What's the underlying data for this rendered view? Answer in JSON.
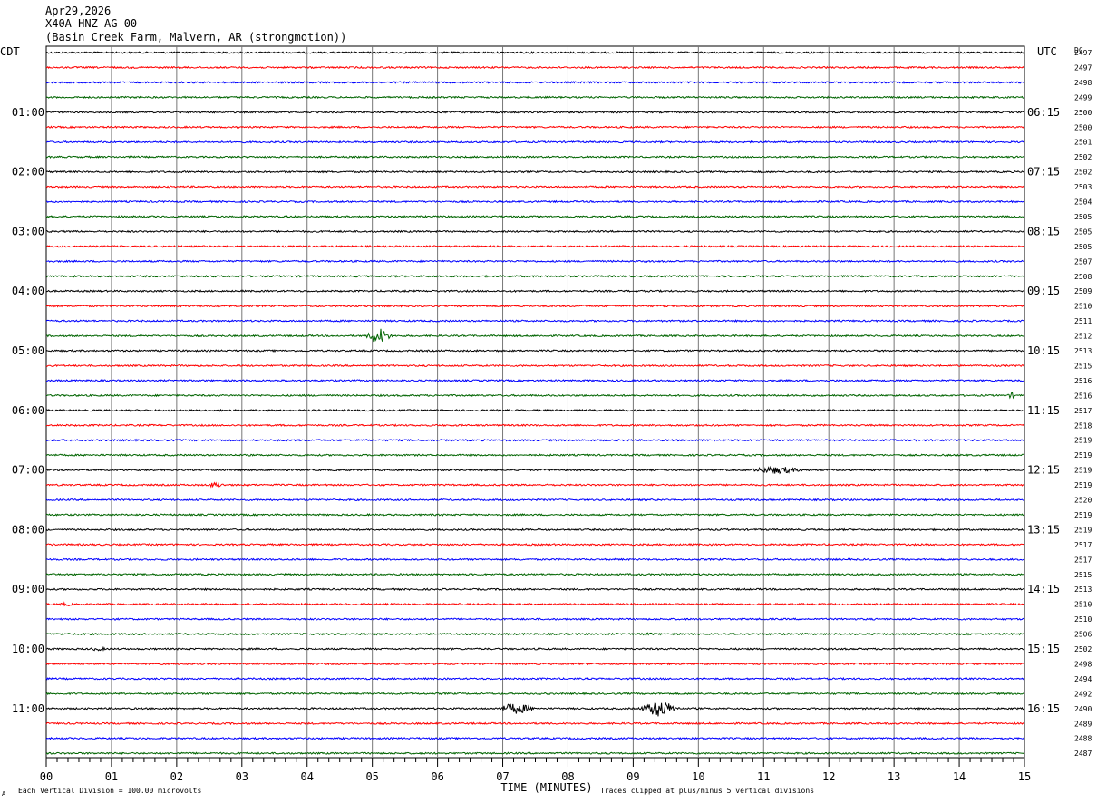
{
  "header": {
    "date": "Apr29,2026",
    "station": "X40A HNZ AG 00",
    "location": "(Basin Creek Farm, Malvern, AR (strongmotion))"
  },
  "chart_data": {
    "type": "line",
    "title": "Apr29,2026 X40A HNZ AG 00 (Basin Creek Farm, Malvern, AR (strongmotion))",
    "xlabel": "TIME (MINUTES)",
    "left_axis_label": "CDT",
    "right_axis_label": "UTC",
    "dc_label": "DC",
    "xlim": [
      0,
      15
    ],
    "x_ticks": [
      "00",
      "01",
      "02",
      "03",
      "04",
      "05",
      "06",
      "07",
      "08",
      "09",
      "10",
      "11",
      "12",
      "13",
      "14",
      "15"
    ],
    "left_hour_labels": [
      "01:00",
      "02:00",
      "03:00",
      "04:00",
      "05:00",
      "06:00",
      "07:00",
      "08:00",
      "09:00",
      "10:00",
      "11:00"
    ],
    "right_hour_labels": [
      "06:15",
      "07:15",
      "08:15",
      "09:15",
      "10:15",
      "11:15",
      "12:15",
      "13:15",
      "14:15",
      "15:15",
      "16:15"
    ],
    "trace_count": 48,
    "trace_colors": [
      "#000000",
      "#ff0000",
      "#0000ff",
      "#006400"
    ],
    "dc_values": [
      2497,
      2497,
      2498,
      2499,
      2500,
      2500,
      2501,
      2502,
      2502,
      2503,
      2504,
      2505,
      2505,
      2505,
      2507,
      2508,
      2509,
      2510,
      2511,
      2512,
      2513,
      2515,
      2516,
      2516,
      2517,
      2518,
      2519,
      2519,
      2519,
      2519,
      2520,
      2519,
      2519,
      2517,
      2517,
      2515,
      2513,
      2510,
      2510,
      2506,
      2502,
      2498,
      2494,
      2492,
      2490,
      2489,
      2488,
      2487
    ],
    "events": [
      {
        "trace": 19,
        "minute": 5.1,
        "amplitude": 9,
        "duration": 0.6
      },
      {
        "trace": 23,
        "minute": 14.8,
        "amplitude": 3,
        "duration": 0.3
      },
      {
        "trace": 28,
        "minute": 11.2,
        "amplitude": 4,
        "duration": 1.4
      },
      {
        "trace": 29,
        "minute": 2.6,
        "amplitude": 3,
        "duration": 0.5
      },
      {
        "trace": 37,
        "minute": 0.3,
        "amplitude": 2,
        "duration": 0.5
      },
      {
        "trace": 39,
        "minute": 9.2,
        "amplitude": 2,
        "duration": 0.5
      },
      {
        "trace": 40,
        "minute": 0.8,
        "amplitude": 2,
        "duration": 0.6
      },
      {
        "trace": 44,
        "minute": 7.2,
        "amplitude": 6,
        "duration": 0.9
      },
      {
        "trace": 44,
        "minute": 9.4,
        "amplitude": 9,
        "duration": 0.9
      }
    ],
    "footer_left": "Each Vertical Division =  100.00 microvolts",
    "footer_right": "Traces clipped at plus/minus 5 vertical divisions",
    "footer_corner": "A"
  }
}
